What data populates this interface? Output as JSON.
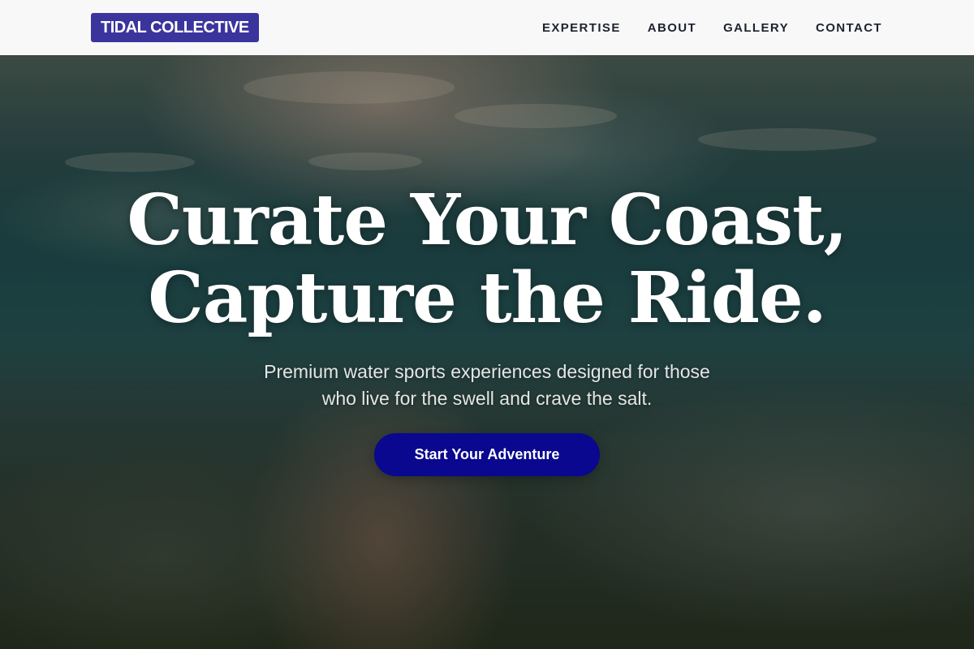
{
  "header": {
    "logo_text": "TIDAL COLLECTIVE",
    "nav": [
      {
        "label": "EXPERTISE"
      },
      {
        "label": "ABOUT"
      },
      {
        "label": "GALLERY"
      },
      {
        "label": "CONTACT"
      }
    ]
  },
  "hero": {
    "title_line_1": "Curate Your Coast,",
    "title_line_2": "Capture the Ride.",
    "subtitle_line_1": "Premium water sports experiences designed for those",
    "subtitle_line_2": "who live for the swell and crave the salt.",
    "cta_label": "Start Your Adventure",
    "background_image": "underwater-swimmer-photo"
  },
  "colors": {
    "header_background": "#f8f8f8",
    "logo_background": "#3b349c",
    "nav_text": "#1e2330",
    "cta_background": "#09088e",
    "hero_text": "#ffffff"
  }
}
